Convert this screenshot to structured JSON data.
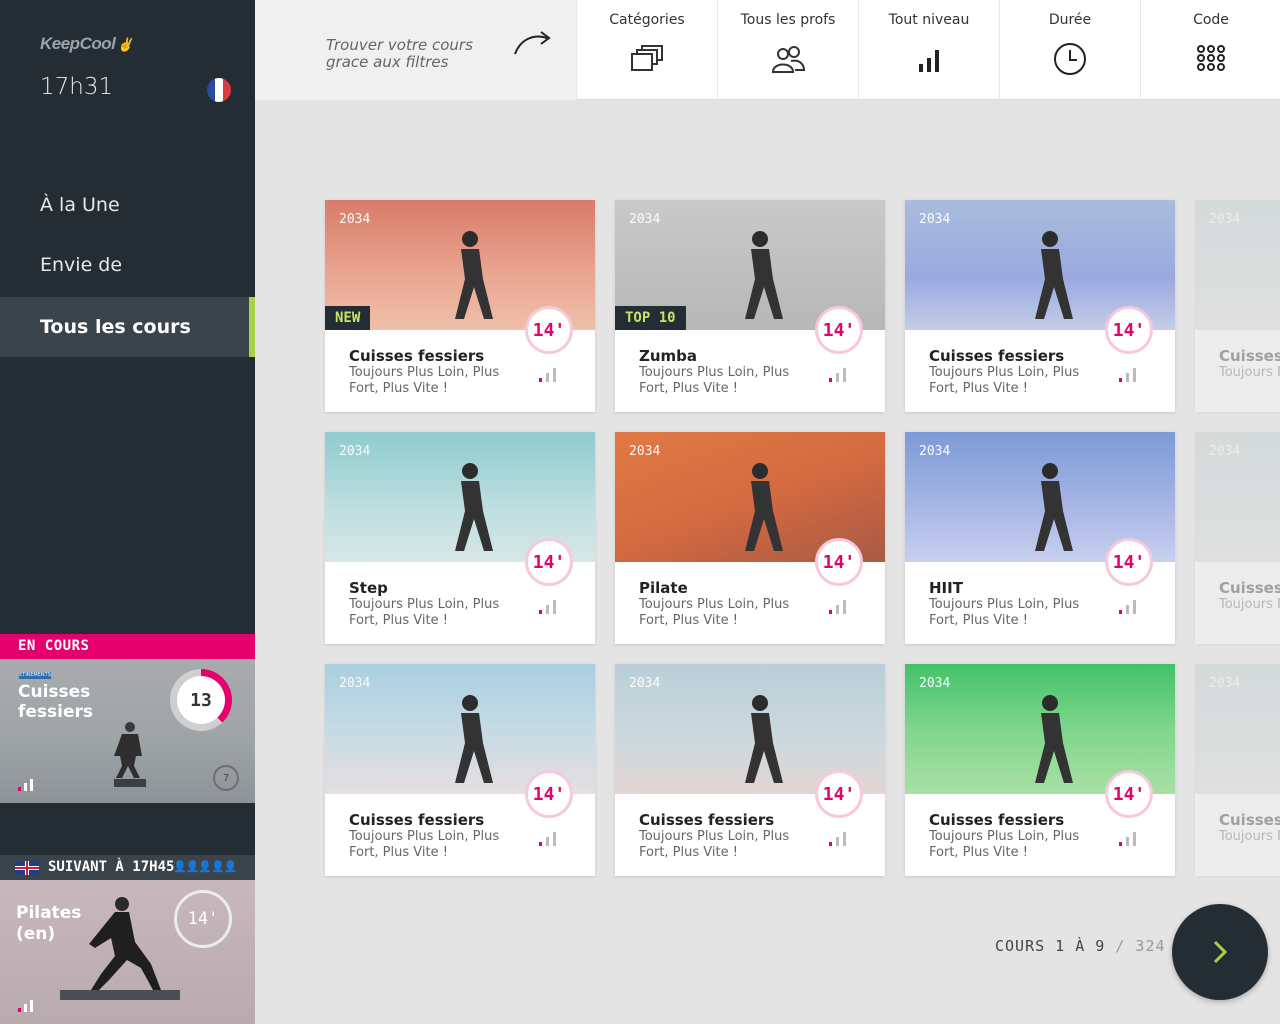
{
  "app": {
    "logo": "KeepCool",
    "time": "17h31"
  },
  "sidebar": {
    "nav": [
      {
        "label": "À la Une"
      },
      {
        "label": "Envie de"
      },
      {
        "label": "Tous les cours"
      }
    ],
    "en_cours": {
      "header": "EN COURS",
      "tag": "ÉTIREMENTS",
      "title": "Cuisses fessiers",
      "remaining": "13",
      "participants": "7"
    },
    "suivant": {
      "header": "SUIVANT À 17H45",
      "title": "Pilates (en)",
      "duration": "14'"
    }
  },
  "topbar": {
    "hint": "Trouver votre cours grace aux filtres",
    "filters": [
      {
        "label": "Catégories",
        "icon": "categories-icon"
      },
      {
        "label": "Tous les profs",
        "icon": "people-icon"
      },
      {
        "label": "Tout niveau",
        "icon": "level-bars-icon"
      },
      {
        "label": "Durée",
        "icon": "clock-icon"
      },
      {
        "label": "Code",
        "icon": "keypad-icon"
      }
    ]
  },
  "courses": [
    {
      "year": "2034",
      "badge": "NEW",
      "title": "Cuisses fessiers",
      "sub": "Toujours Plus Loin, Plus Fort, Plus Vite !",
      "duration": "14'",
      "bg": "linear-gradient(180deg,#d97b6a 0%,#e8a48f 55%,#f0c0aa 100%)"
    },
    {
      "year": "2034",
      "badge": "TOP 10",
      "title": "Zumba",
      "sub": "Toujours Plus Loin, Plus Fort, Plus Vite !",
      "duration": "14'",
      "bg": "linear-gradient(180deg,#c9c9c9 0%,#b7b7b7 100%)"
    },
    {
      "year": "2034",
      "badge": "",
      "title": "Cuisses fessiers",
      "sub": "Toujours Plus Loin, Plus Fort, Plus Vite !",
      "duration": "14'",
      "bg": "linear-gradient(180deg,#a9bcdc 0%,#9aa9e0 60%,#c5cde8 100%)"
    },
    {
      "year": "2034",
      "badge": "",
      "title": "Step",
      "sub": "Toujours Plus Loin, Plus Fort, Plus Vite !",
      "duration": "14'",
      "bg": "linear-gradient(180deg,#8fcbcf 0%,#bfdfe0 60%,#d8e6e6 100%)"
    },
    {
      "year": "2034",
      "badge": "",
      "title": "Pilate",
      "sub": "Toujours Plus Loin, Plus Fort, Plus Vite !",
      "duration": "14'",
      "bg": "linear-gradient(160deg,#e07a45 0%,#d56a40 50%,#a85a45 100%)"
    },
    {
      "year": "2034",
      "badge": "",
      "title": "HIIT",
      "sub": "Toujours Plus Loin, Plus Fort, Plus Vite !",
      "duration": "14'",
      "bg": "linear-gradient(180deg,#7d9ad8 0%,#a9b7e6 60%,#c7d0ee 100%)"
    },
    {
      "year": "2034",
      "badge": "",
      "title": "Cuisses fessiers",
      "sub": "Toujours Plus Loin, Plus Fort, Plus Vite !",
      "duration": "14'",
      "bg": "linear-gradient(180deg,#a9cfe0 0%,#c8dbe4 55%,#e6dfe0 100%)"
    },
    {
      "year": "2034",
      "badge": "",
      "title": "Cuisses fessiers",
      "sub": "Toujours Plus Loin, Plus Fort, Plus Vite !",
      "duration": "14'",
      "bg": "linear-gradient(180deg,#b9cfd8 0%,#cbd8dd 55%,#e2d6d2 100%)"
    },
    {
      "year": "2034",
      "badge": "",
      "title": "Cuisses fessiers",
      "sub": "Toujours Plus Loin, Plus Fort, Plus Vite !",
      "duration": "14'",
      "bg": "linear-gradient(180deg,#42c26a 0%,#7fd68c 50%,#a9e0a5 100%)"
    }
  ],
  "peek": [
    {
      "year": "2034",
      "title": "Cuisses",
      "sub": "Toujours Plus Fort"
    },
    {
      "year": "2034",
      "title": "Cuisses",
      "sub": "Toujours Plus Fort"
    },
    {
      "year": "2034",
      "title": "Cuisses",
      "sub": "Toujours Plus Fort"
    }
  ],
  "pager": {
    "label": "COURS 1 À 9",
    "total": "/ 324"
  },
  "colors": {
    "accent": "#e5006d",
    "sidebar": "#242d33",
    "active_bar": "#a5d24a",
    "badge_text": "#c9e36a"
  }
}
